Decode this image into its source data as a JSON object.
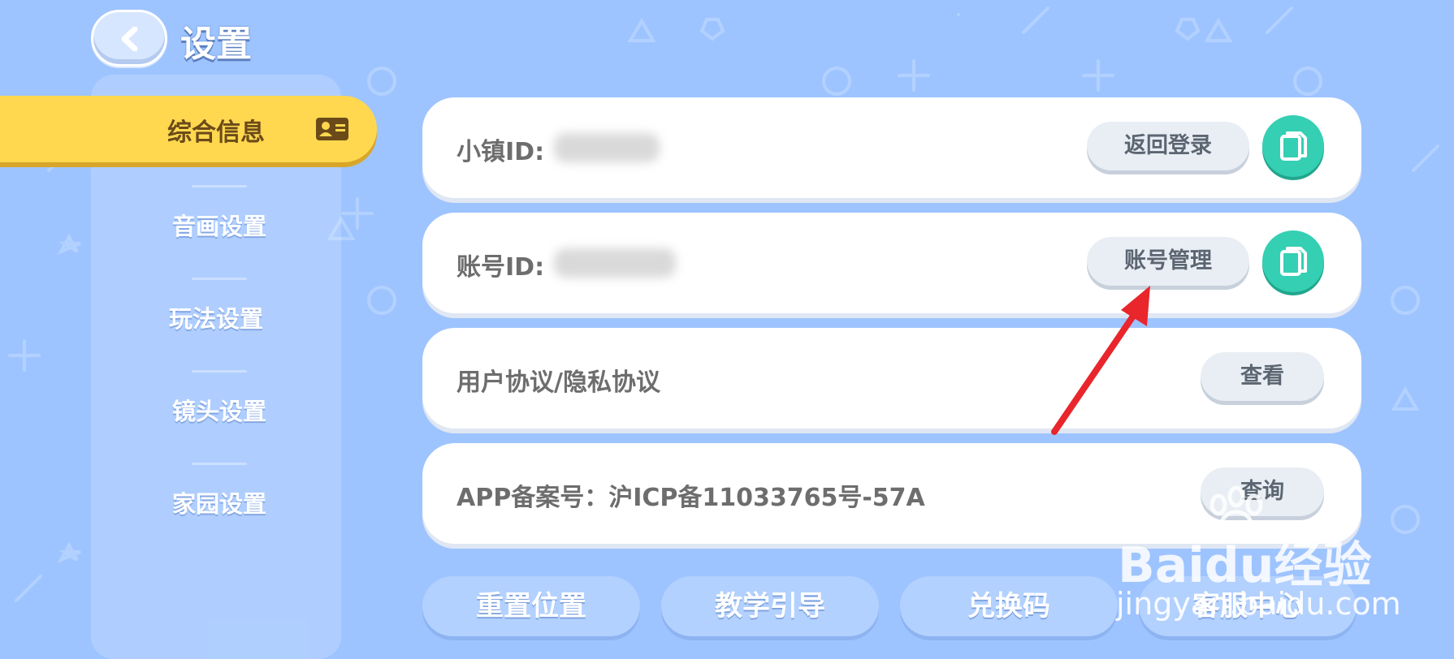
{
  "header": {
    "title": "设置",
    "back_icon": "chevron-left-icon"
  },
  "sidebar": {
    "active": {
      "label": "综合信息",
      "icon": "id-card-icon"
    },
    "items": [
      {
        "label": "音画设置"
      },
      {
        "label": "玩法设置"
      },
      {
        "label": "镜头设置"
      },
      {
        "label": "家园设置"
      }
    ]
  },
  "rows": {
    "town_id": {
      "label": "小镇ID:",
      "button": "返回登录",
      "copy_icon": "copy-icon"
    },
    "account_id": {
      "label": "账号ID:",
      "button": "账号管理",
      "copy_icon": "copy-icon"
    },
    "agreement": {
      "label": "用户协议/隐私协议",
      "button": "查看"
    },
    "filing": {
      "label": "APP备案号：沪ICP备11033765号-57A",
      "button": "查询"
    }
  },
  "bottom_buttons": [
    "重置位置",
    "教学引导",
    "兑换码",
    "客服中心"
  ],
  "watermark": {
    "brand": "Baidu经验",
    "url": "jingyan.baidu.com"
  },
  "colors": {
    "background": "#9ec4ff",
    "active_tab": "#ffd84f",
    "copy_button": "#35cfb3",
    "arrow": "#e8262c"
  }
}
